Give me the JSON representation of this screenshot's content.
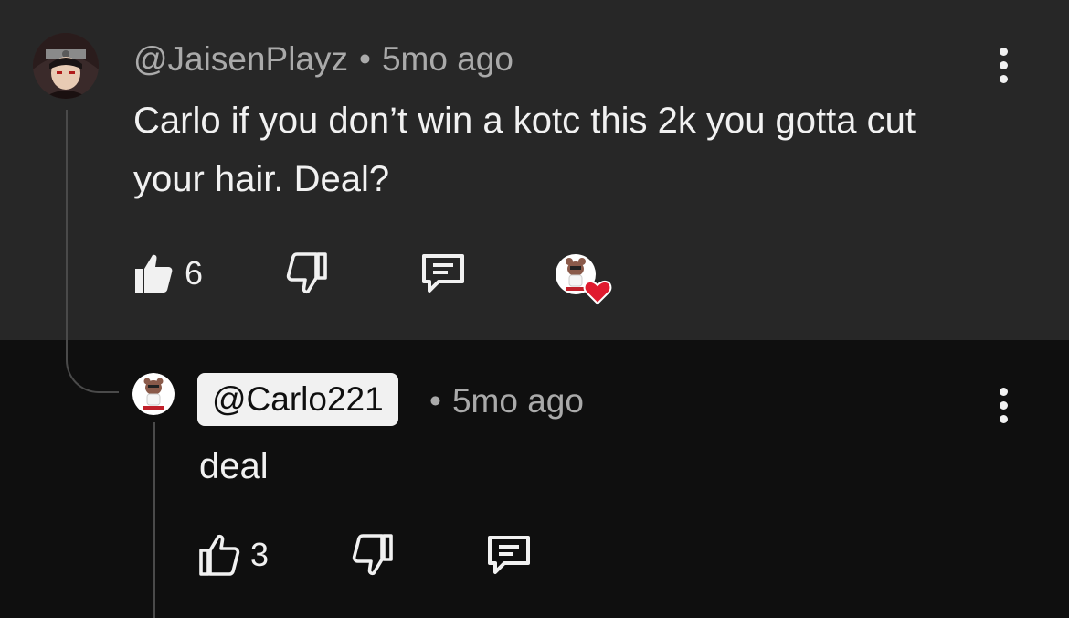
{
  "comment": {
    "author": "@JaisenPlayz",
    "separator": "•",
    "time": "5mo ago",
    "text": "Carlo if you don’t win a kotc this 2k you gotta cut your hair. Deal?",
    "likes": "6"
  },
  "reply": {
    "author": "@Carlo221",
    "separator": "•",
    "time": "5mo ago",
    "text": "deal",
    "likes": "3"
  },
  "icons": {
    "like": "thumbs-up-icon",
    "dislike": "thumbs-down-icon",
    "reply": "reply-comment-icon",
    "more": "more-vertical-icon",
    "heart": "heart-icon"
  },
  "colors": {
    "heart": "#e01b2f",
    "highlight_bg": "#272727",
    "pill_bg": "#f1f1f1"
  }
}
